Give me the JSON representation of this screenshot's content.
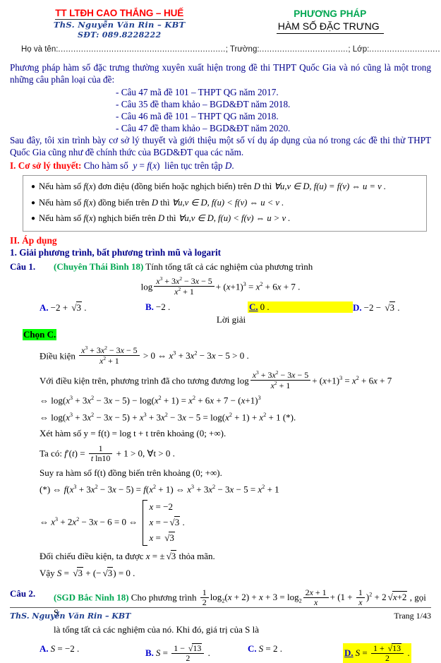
{
  "header": {
    "school": "TT LTĐH CAO THẮNG – HUẾ",
    "teacher": "ThS. Nguyễn Văn Rin – KBT",
    "phone": "SĐT: 089.8228222",
    "doc_kind": "PHƯƠNG PHÁP",
    "doc_title": "HÀM SỐ ĐẶC TRƯNG",
    "fill_name_label": "Họ và tên:",
    "fill_name_dots": "..................................................................",
    "fill_school_label": "; Trường:",
    "fill_school_dots": "...................................",
    "fill_class_label": "; Lớp:",
    "fill_class_dots": "..............................."
  },
  "intro": {
    "paragraph1": "Phương pháp hàm số đặc trưng thường xuyên xuất hiện trong đề thi THPT Quốc Gia và nó cũng là một trong những câu phân loại của đề:",
    "exam_items": [
      "- Câu 47 mã đề 101 – THPT QG năm 2017.",
      "- Câu 35 đề tham khảo – BGD&ĐT năm 2018.",
      "- Câu 46 mã đề 101 – THPT QG năm 2018.",
      "- Câu 47 đề tham khảo – BGD&ĐT năm 2020."
    ],
    "paragraph2": "Sau đây, tôi xin trình bày cơ sở lý thuyết và giới thiệu một số ví dụ áp dụng của nó trong các đề thi thử THPT Quốc Gia cũng như đề chính thức của BGD&ĐT qua các năm."
  },
  "theory": {
    "section_label": "I. Cơ sở lý thuyết:",
    "section_text_pre": "Cho hàm số",
    "section_fn": "y = f(x)",
    "section_text_post": "liên tục trên tập",
    "section_domain": "D",
    "bullets": [
      {
        "lead": "Nếu hàm số",
        "fn": "f(x)",
        "mid": "đơn điệu (đồng biến hoặc nghịch biến) trên",
        "domain": "D",
        "then": "thì",
        "cond": "∀u,v ∈ D, f(u) = f(v) ⇔ u = v ."
      },
      {
        "lead": "Nếu hàm số",
        "fn": "f(x)",
        "mid": "đồng biến trên",
        "domain": "D",
        "then": "thì",
        "cond": "∀u,v ∈ D, f(u) < f(v) ⇔ u < v ."
      },
      {
        "lead": "Nếu hàm số",
        "fn": "f(x)",
        "mid": "nghịch biến trên",
        "domain": "D",
        "then": "thì",
        "cond": "∀u,v ∈ D, f(u) < f(v) ⇔ u > v ."
      }
    ]
  },
  "application": {
    "section_head": "II. Áp dụng",
    "sub_head": "1. Giải phương trình, bất phương trình mũ và logarit"
  },
  "question1": {
    "label": "Câu 1.",
    "source": "(Chuyên Thái Bình 18)",
    "prompt": "Tính tổng tất cả các nghiệm của phương trình",
    "choices": [
      {
        "letter": "A.",
        "value": "−2 + √3 .",
        "correct": false
      },
      {
        "letter": "B.",
        "value": "−2 .",
        "correct": false
      },
      {
        "letter": "C.",
        "value": "0 .",
        "correct": true
      },
      {
        "letter": "D.",
        "value": "−2 − √3 .",
        "correct": false
      }
    ],
    "solution_heading": "Lời giải",
    "chosen": "Chọn C.",
    "steps": {
      "condition_lead": "Điều kiện",
      "condition_tail": "> 0 ⇔ x³ + 3x² − 3x − 5 > 0 .",
      "step_with_condition": "Với điều kiện trên, phương trình đã cho tương đương",
      "consider_fn": "Xét hàm số y = f(t) = log t + t trên khoảng (0; +∞).",
      "derivative_lead": "Ta có:",
      "derivative_tail": "+ 1 > 0, ∀t > 0 .",
      "monotone": "Suy ra hàm số f(t) đồng biến trên khoảng (0; +∞).",
      "cases": [
        "x = −2",
        "x = −√3 .",
        "x = √3"
      ],
      "compare": "Đối chiếu điều kiện, ta được x = ±√3 thỏa mãn.",
      "final": "Vậy S = √3 + (−√3) = 0 ."
    }
  },
  "question2": {
    "label": "Câu 2.",
    "source": "(SGD Bắc Ninh 18)",
    "prompt_pre": "Cho phương trình",
    "prompt_mid": ", gọi S",
    "prompt_post": "là tổng tất cả các nghiệm của nó. Khi đó, giá trị của S là",
    "choices": [
      {
        "letter": "A.",
        "value": "S = −2 .",
        "correct": false
      },
      {
        "letter": "B.",
        "value": "S = (1 − √13)/2 .",
        "correct": false
      },
      {
        "letter": "C.",
        "value": "S = 2 .",
        "correct": false
      },
      {
        "letter": "D.",
        "value": "S = (1 + √13)/2 .",
        "correct": true
      }
    ]
  },
  "footer": {
    "left": "ThS. Nguyễn Văn Rin – KBT",
    "right": "Trang 1/43"
  },
  "colors": {
    "red": "#ff0000",
    "green": "#00a651",
    "blue": "#00008b",
    "choice_blue": "#0000cd",
    "script_blue": "#1f3f8f",
    "highlight_yellow": "#ffff00",
    "highlight_green": "#00ff00"
  }
}
